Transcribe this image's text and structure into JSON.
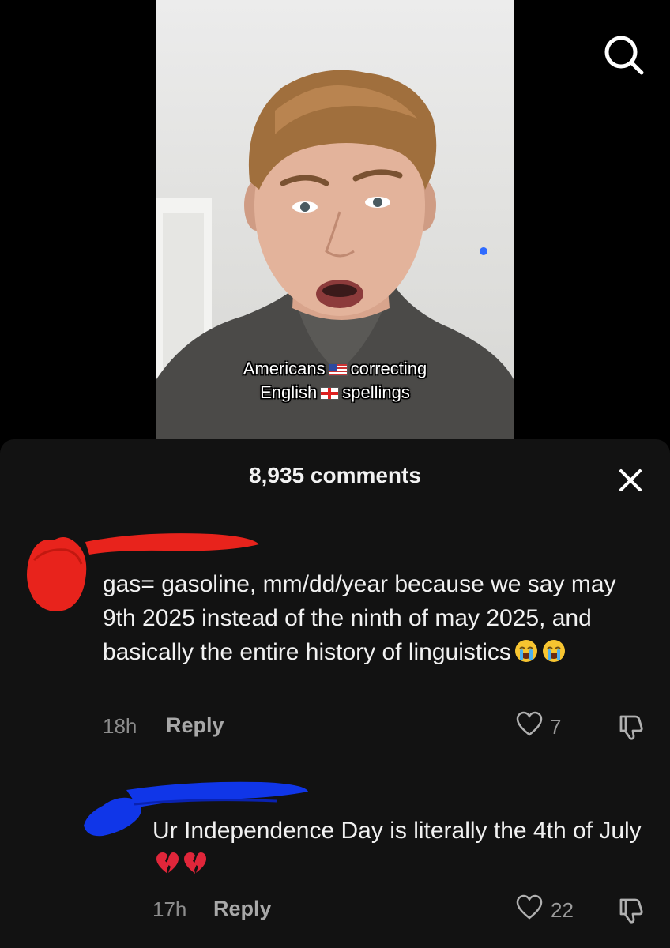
{
  "video": {
    "caption_line1_part1": "Americans",
    "caption_line1_part2": "correcting",
    "caption_line2_part1": "English",
    "caption_line2_part2": "spellings",
    "flag_us": "us-flag-icon",
    "flag_en": "england-flag-icon"
  },
  "header": {
    "search_icon": "search-icon"
  },
  "comments_panel": {
    "count_label": "8,935 comments",
    "close_icon": "close-icon",
    "comments": [
      {
        "text": "gas= gasoline, mm/dd/year because we say may 9th 2025 instead of the ninth of may 2025, and basically the entire history of linguistics",
        "emoji": "loudly-crying-face x2",
        "time": "18h",
        "reply_label": "Reply",
        "likes": "7"
      },
      {
        "text": "Ur Independence Day is literally the 4th of July",
        "emoji": "broken-heart x2",
        "time": "17h",
        "reply_label": "Reply",
        "likes": "22"
      }
    ]
  },
  "colors": {
    "panel_bg": "#121212",
    "redaction_red": "#e8231c",
    "redaction_blue": "#1036e8"
  }
}
